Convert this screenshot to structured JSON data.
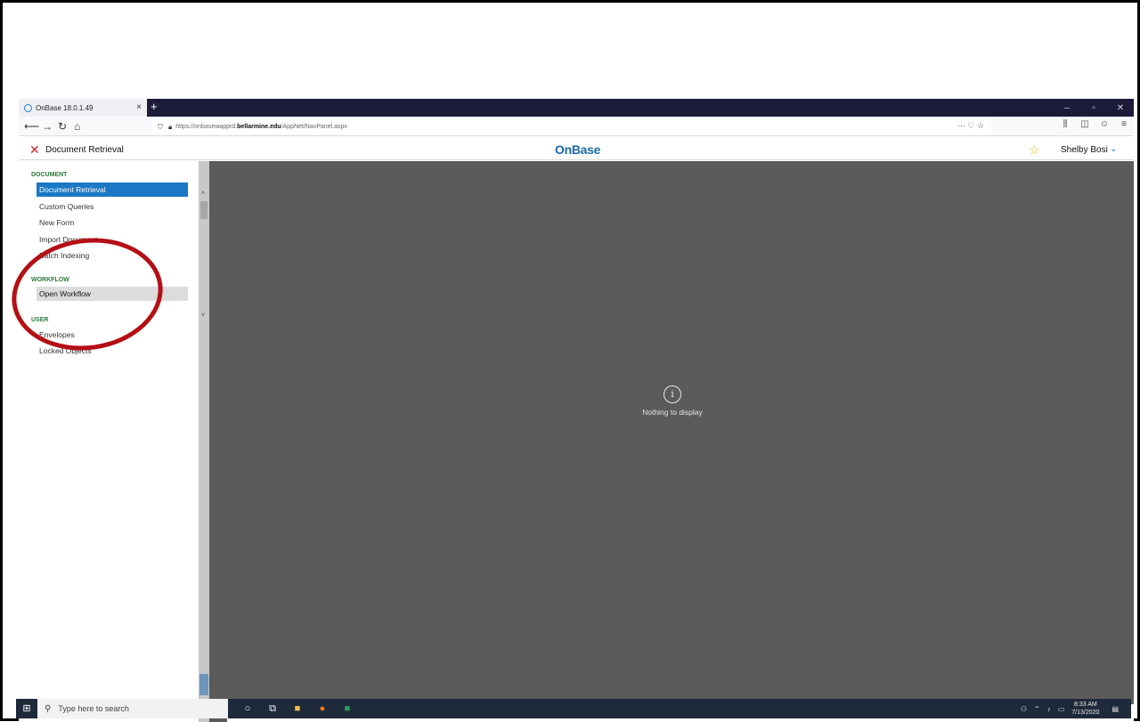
{
  "browser": {
    "tab_title": "OnBase 18.0.1.49",
    "tab_close": "×",
    "new_tab": "+",
    "window_controls": [
      "–",
      "▫",
      "✕"
    ],
    "url_prefix": "https://onbasewapprd.",
    "url_domain": "bellarmine.edu",
    "url_path": "/AppNet/NavPanel.aspx",
    "url_actions": "··· ♡ ☆",
    "toolbar_right": [
      "⫼",
      "◫",
      "☺",
      "≡"
    ],
    "nav_icons": [
      "back-icon",
      "forward-icon",
      "reload-icon",
      "home-icon"
    ]
  },
  "header": {
    "close_glyph": "✕",
    "title": "Document Retrieval",
    "logo": "OnBase",
    "favorite_glyph": "☆",
    "user_name": "Shelby Bosi",
    "user_chevron": "⌄"
  },
  "sidebar": {
    "document_section": "DOCUMENT",
    "document_items": [
      "Document Retrieval",
      "Custom Queries",
      "New Form",
      "Import Document",
      "Batch Indexing"
    ],
    "workflow_section": "WORKFLOW",
    "workflow_items": [
      "Open Workflow"
    ],
    "user_section": "USER",
    "user_items": [
      "Envelopes",
      "Locked Objects"
    ]
  },
  "content": {
    "empty_icon": "i",
    "empty_message": "Nothing to display"
  },
  "taskbar": {
    "search_placeholder": "Type here to search",
    "time": "8:33 AM",
    "date": "7/13/2020"
  },
  "colors": {
    "accent": "#1a78c4",
    "brand": "#1b6aa8",
    "section_green": "#2a7a3a",
    "annotation": "#b50f16",
    "content_bg": "#5b5b5b"
  }
}
